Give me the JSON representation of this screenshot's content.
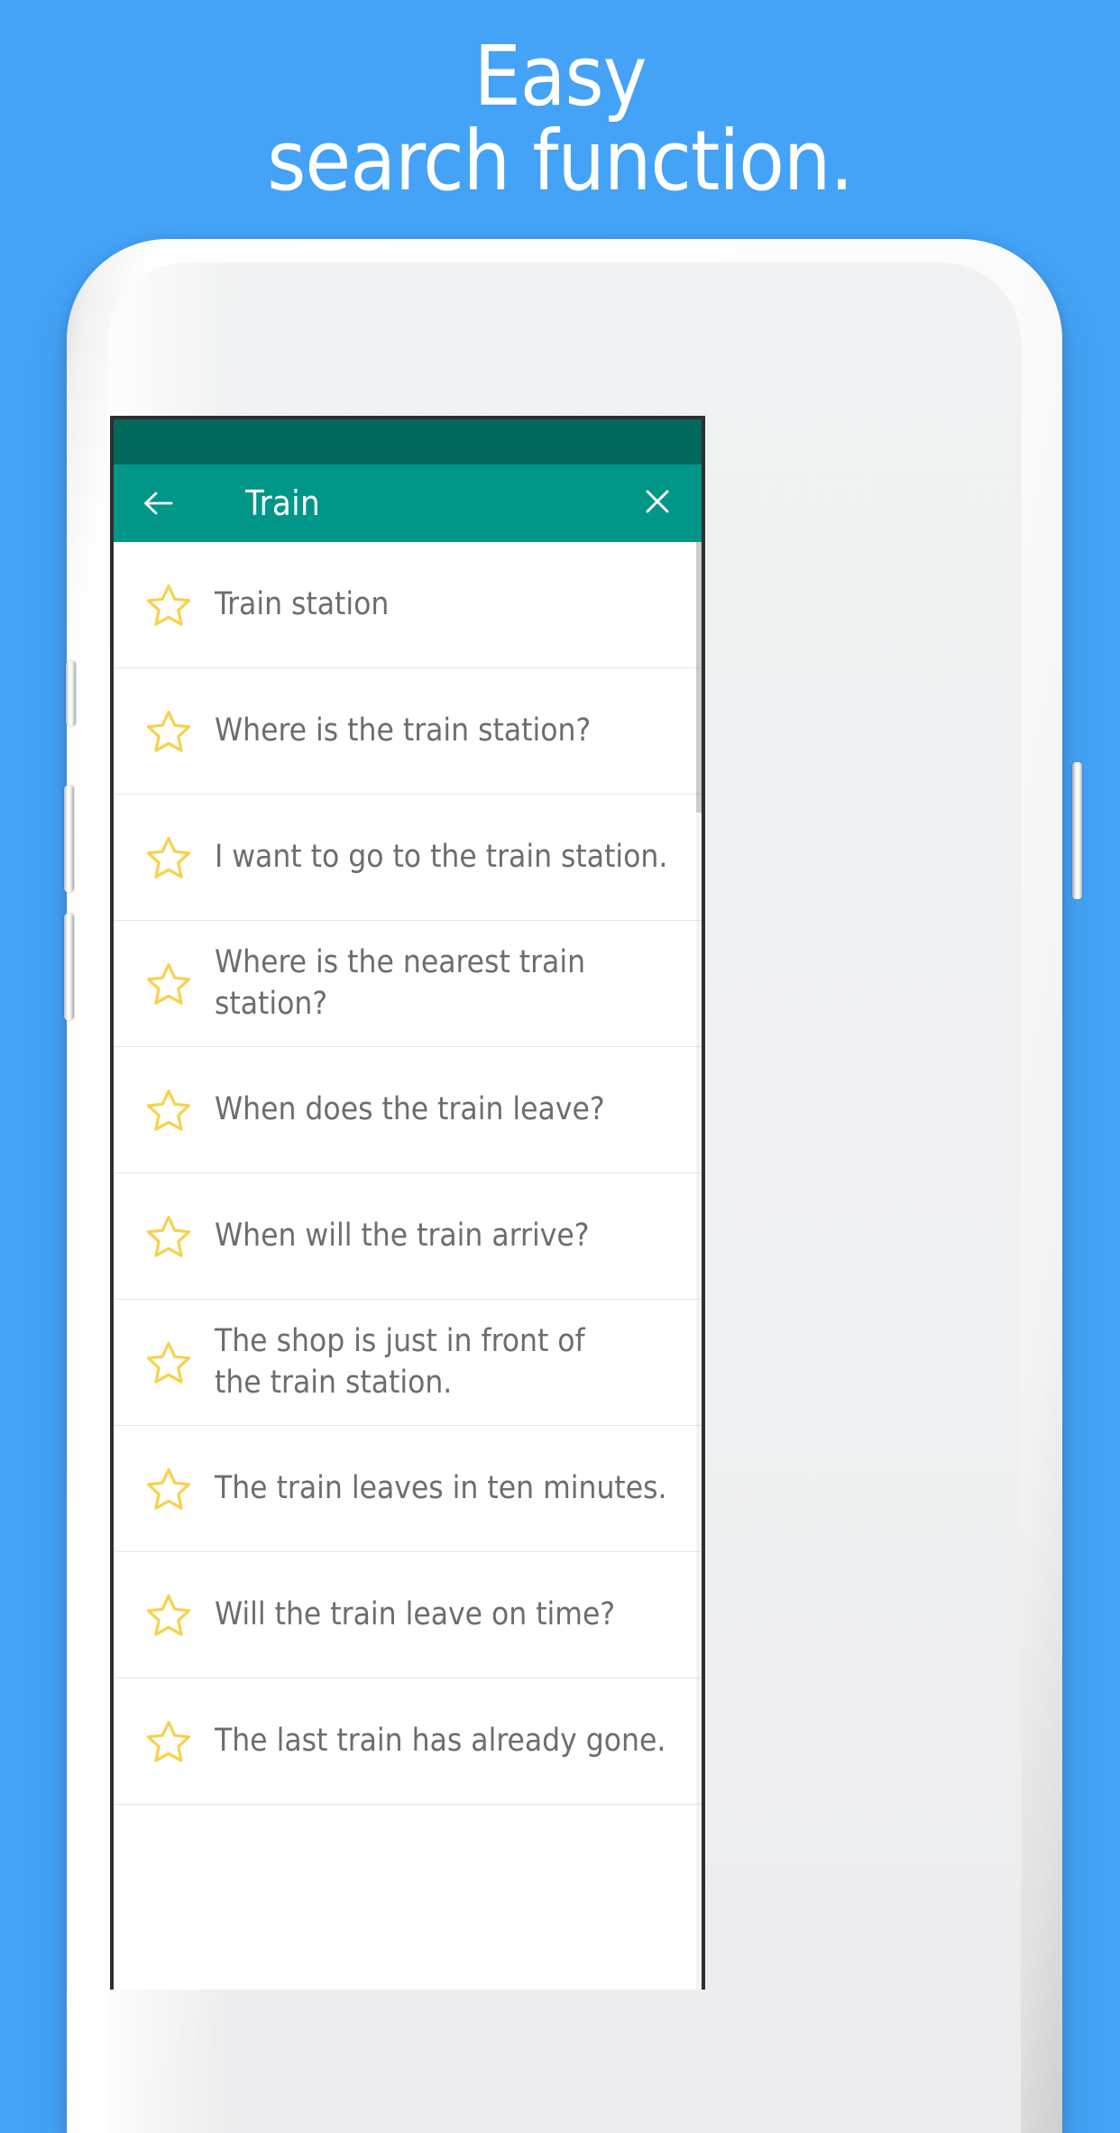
{
  "headline": {
    "line1": "Easy",
    "line2": "search function.",
    "text": "Easy\nsearch function."
  },
  "colors": {
    "background_blue": "#44a3f7",
    "statusbar_teal": "#00695c",
    "toolbar_teal": "#009688",
    "star_yellow": "#f6d24d",
    "row_text_gray": "#6d6d6d",
    "divider_gray": "#e6e6e6"
  },
  "app": {
    "toolbar": {
      "back_icon": "arrow-left-icon",
      "title": "Train",
      "close_icon": "close-icon"
    },
    "list": {
      "star_icon": "star-outline-icon",
      "rows": [
        {
          "text": "Train station"
        },
        {
          "text": "Where is the train station?"
        },
        {
          "text": "I want to go to the train station."
        },
        {
          "text": "Where is the nearest train station?"
        },
        {
          "text": "When does the train leave?"
        },
        {
          "text": "When will the train arrive?"
        },
        {
          "text": "The shop is just in front of the train station."
        },
        {
          "text": "The train leaves in ten minutes."
        },
        {
          "text": "Will the train leave on time?"
        },
        {
          "text": "The last train has already gone."
        }
      ]
    }
  },
  "device": {
    "camera_icon": "front-camera-icon",
    "sensor_icon": "proximity-sensor-icon",
    "speaker_icon": "earpiece-speaker-icon",
    "button_silent": "silent-switch",
    "button_volume_up": "volume-up-button",
    "button_volume_down": "volume-down-button",
    "button_power": "power-button"
  }
}
